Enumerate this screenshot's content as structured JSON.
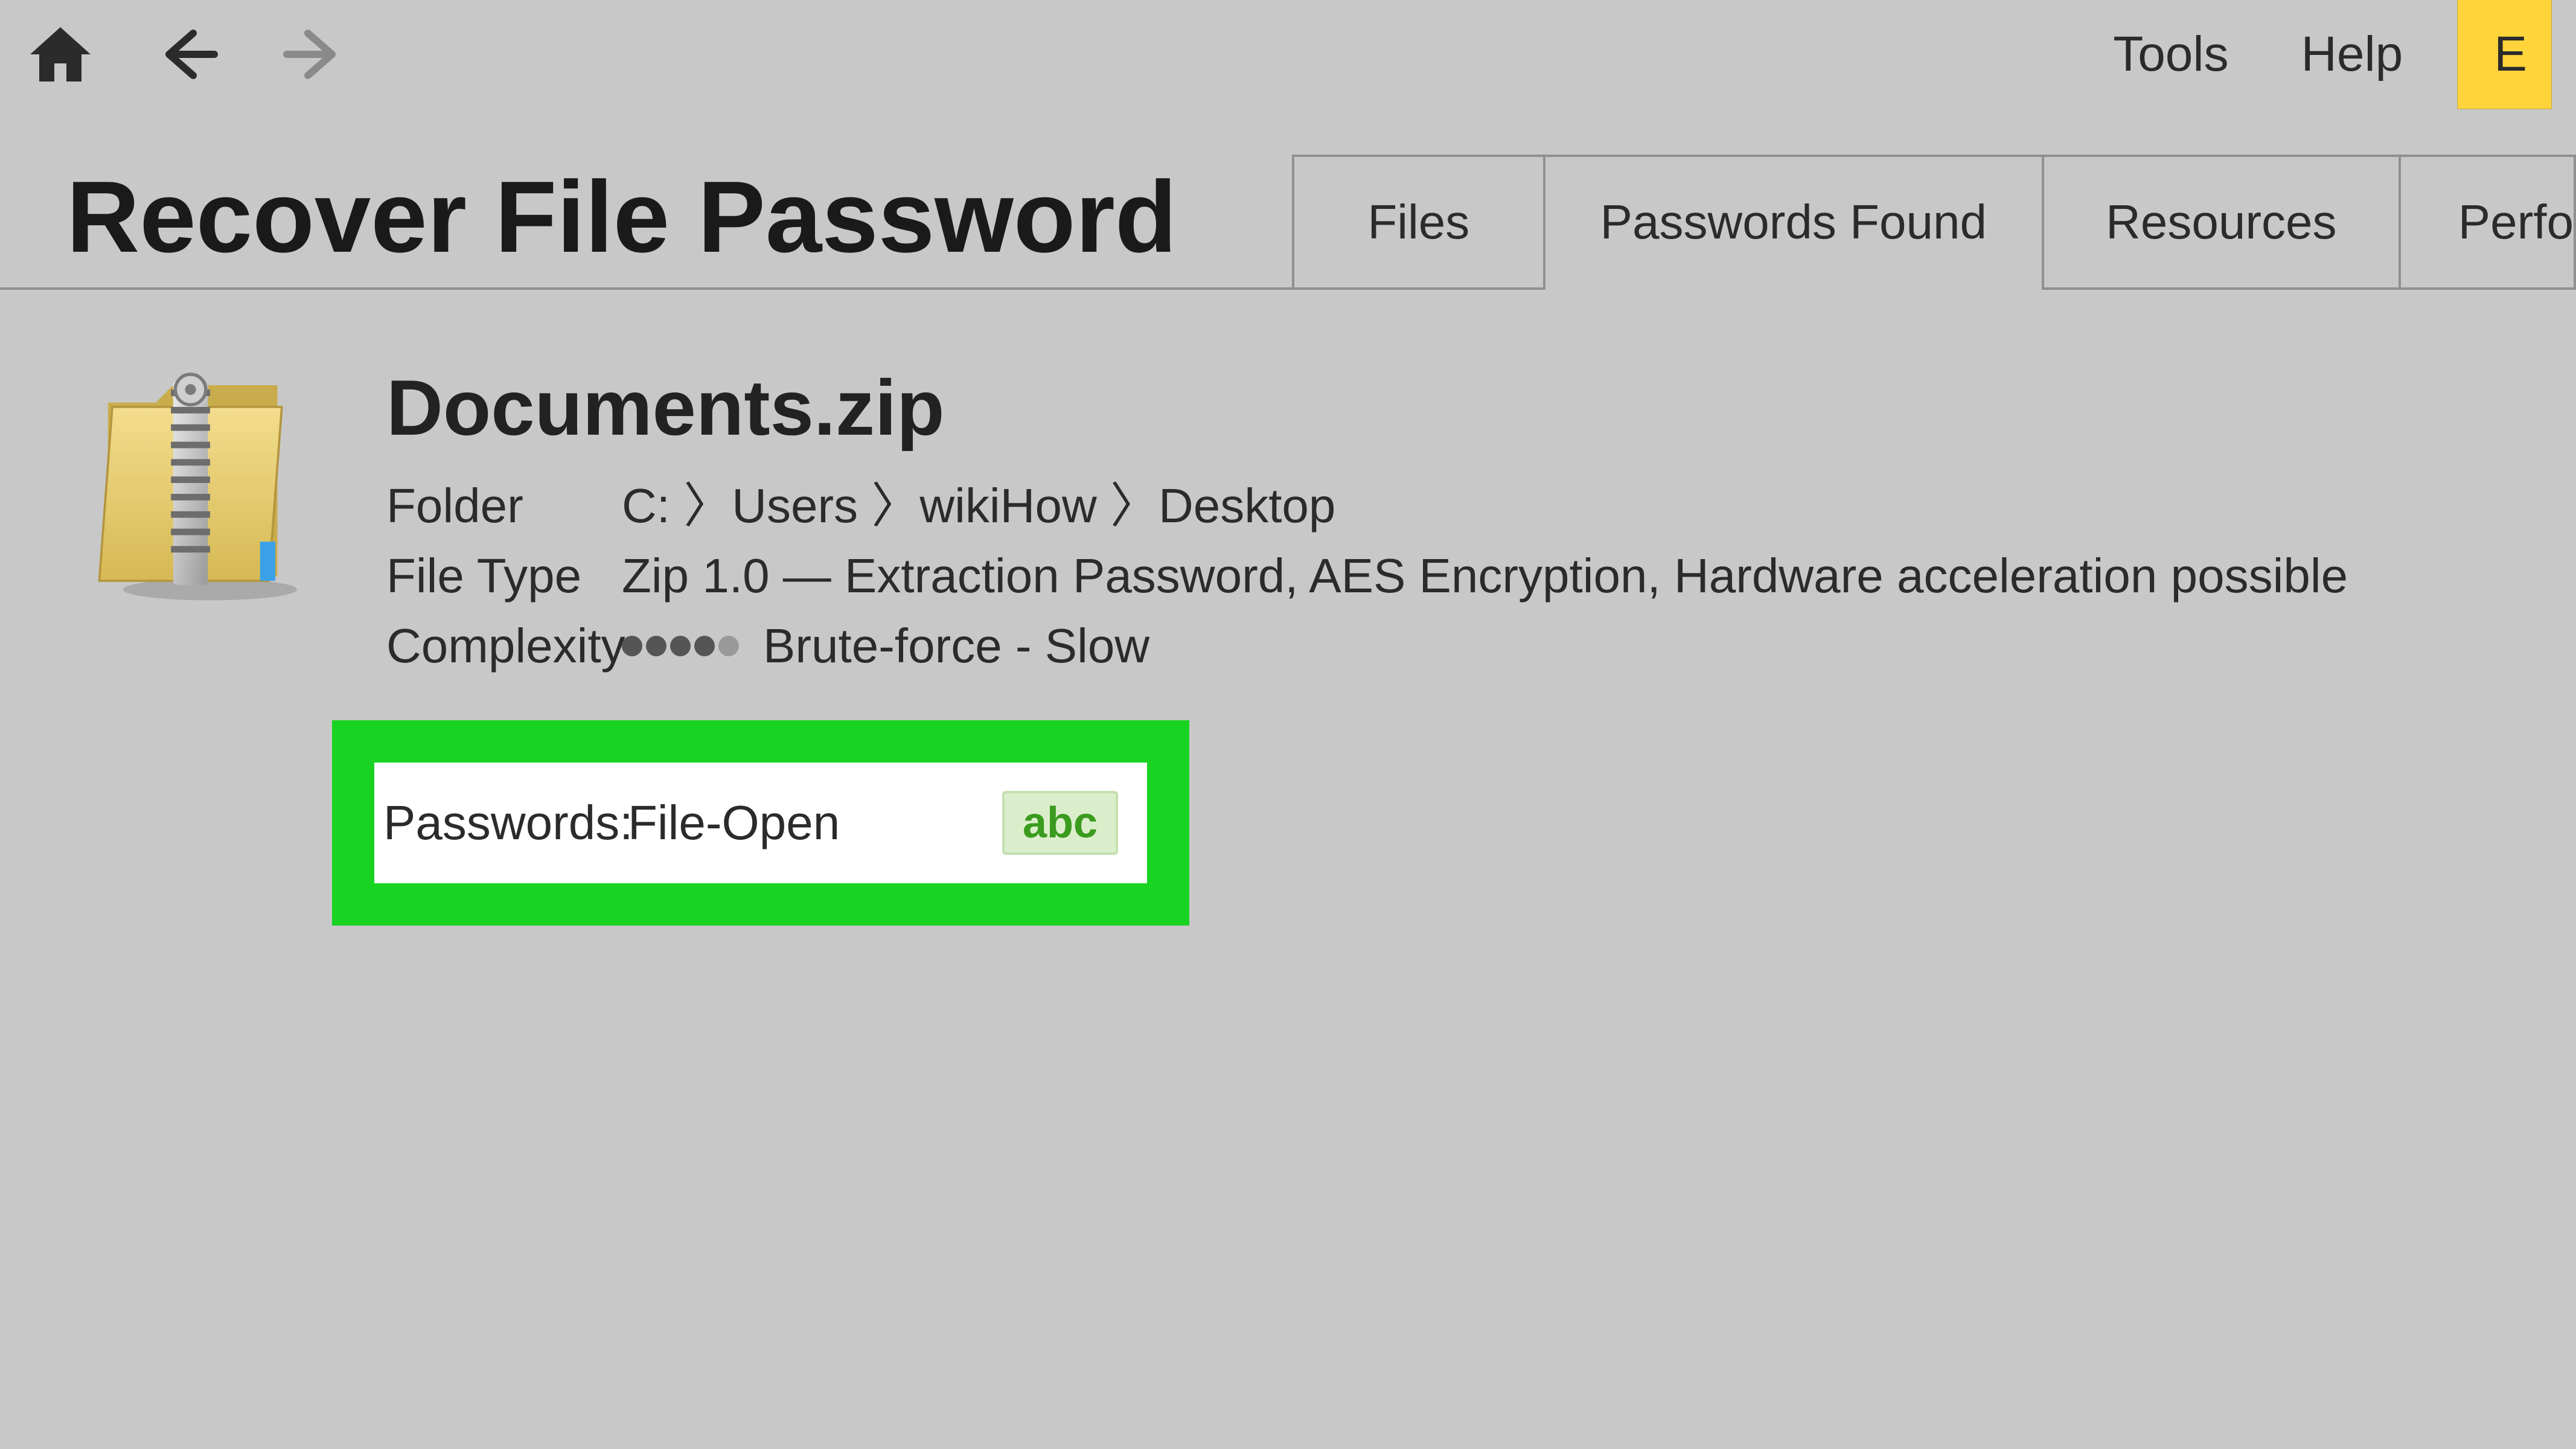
{
  "toolbar": {
    "menu": {
      "tools": "Tools",
      "help": "Help",
      "buy_prefix": "E"
    }
  },
  "page": {
    "title": "Recover File Password"
  },
  "tabs": {
    "files": "Files",
    "passwords_found": "Passwords Found",
    "resources": "Resources",
    "performance_prefix": "Perfo"
  },
  "file": {
    "name": "Documents.zip",
    "folder_label": "Folder",
    "folder_value": "C: 〉Users 〉wikiHow 〉Desktop",
    "type_label": "File Type",
    "type_value": "Zip 1.0 — Extraction Password, AES Encryption, Hardware acceleration possible",
    "complexity_label": "Complexity",
    "complexity_value": "Brute-force - Slow",
    "complexity_filled_dots": 4,
    "complexity_total_dots": 5
  },
  "passwords_box": {
    "label": "Passwords:",
    "value": "File-Open",
    "chip": "abc"
  },
  "colors": {
    "highlight_green": "#18d321",
    "chip_bg": "#dbeecb",
    "chip_text": "#3a9b1f",
    "buy_yellow": "#ffd43b"
  }
}
